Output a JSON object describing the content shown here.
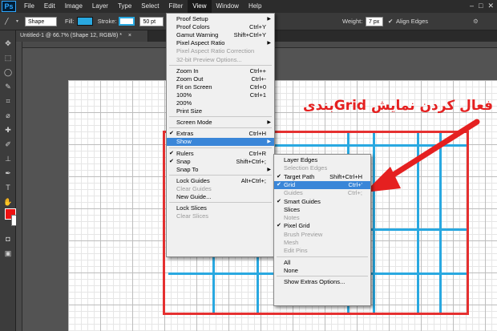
{
  "app": {
    "logo": "Ps"
  },
  "menubar": {
    "items": [
      "File",
      "Edit",
      "Image",
      "Layer",
      "Type",
      "Select",
      "Filter",
      "View",
      "Window",
      "Help"
    ],
    "active_index": 7
  },
  "window_controls": {
    "minimize": "–",
    "maximize": "□",
    "close": "✕"
  },
  "options_bar": {
    "mode": "Shape",
    "fill_label": "Fill:",
    "stroke_label": "Stroke:",
    "stroke_width": "50 pt",
    "weight_label": "Weight:",
    "weight_value": "7 px",
    "align_edges_label": "Align Edges",
    "fill_color": "#29a8e0"
  },
  "document_tab": {
    "title": "Untitled-1 @ 66.7% (Shape 12, RGB/8) *",
    "close": "×"
  },
  "view_menu": {
    "items": [
      {
        "label": "Proof Setup",
        "submenu": true
      },
      {
        "label": "Proof Colors",
        "shortcut": "Ctrl+Y"
      },
      {
        "label": "Gamut Warning",
        "shortcut": "Shift+Ctrl+Y"
      },
      {
        "label": "Pixel Aspect Ratio",
        "submenu": true
      },
      {
        "label": "Pixel Aspect Ratio Correction",
        "disabled": true
      },
      {
        "label": "32-bit Preview Options...",
        "disabled": true
      },
      {
        "label": "Zoom In",
        "shortcut": "Ctrl++"
      },
      {
        "label": "Zoom Out",
        "shortcut": "Ctrl+-"
      },
      {
        "label": "Fit on Screen",
        "shortcut": "Ctrl+0"
      },
      {
        "label": "100%",
        "shortcut": "Ctrl+1"
      },
      {
        "label": "200%"
      },
      {
        "label": "Print Size"
      },
      {
        "label": "Screen Mode",
        "submenu": true
      },
      {
        "label": "Extras",
        "shortcut": "Ctrl+H",
        "checked": true
      },
      {
        "label": "Show",
        "submenu": true,
        "highlighted": true
      },
      {
        "label": "Rulers",
        "shortcut": "Ctrl+R",
        "checked": true
      },
      {
        "label": "Snap",
        "shortcut": "Shift+Ctrl+;",
        "checked": true
      },
      {
        "label": "Snap To",
        "submenu": true
      },
      {
        "label": "Lock Guides",
        "shortcut": "Alt+Ctrl+;"
      },
      {
        "label": "Clear Guides",
        "disabled": true
      },
      {
        "label": "New Guide..."
      },
      {
        "label": "Lock Slices"
      },
      {
        "label": "Clear Slices",
        "disabled": true
      }
    ]
  },
  "show_menu": {
    "items": [
      {
        "label": "Layer Edges"
      },
      {
        "label": "Selection Edges",
        "disabled": true
      },
      {
        "label": "Target Path",
        "shortcut": "Shift+Ctrl+H",
        "checked": true
      },
      {
        "label": "Grid",
        "shortcut": "Ctrl+'",
        "checked": true,
        "highlighted": true
      },
      {
        "label": "Guides",
        "shortcut": "Ctrl+;",
        "disabled": true
      },
      {
        "label": "Smart Guides",
        "checked": true
      },
      {
        "label": "Slices"
      },
      {
        "label": "Notes",
        "disabled": true
      },
      {
        "label": "Pixel Grid",
        "checked": true
      },
      {
        "label": "Brush Preview",
        "disabled": true
      },
      {
        "label": "Mesh",
        "disabled": true
      },
      {
        "label": "Edit Pins",
        "disabled": true
      },
      {
        "label": "All"
      },
      {
        "label": "None"
      },
      {
        "label": "Show Extras Options..."
      }
    ]
  },
  "annotation": {
    "text": "فعال کردن نمایش Gridبندی",
    "color": "#e52020"
  },
  "colors": {
    "foreground": "#e11111",
    "background": "#ffffff",
    "accent": "#29a8e0",
    "highlight": "#3a86d8"
  }
}
